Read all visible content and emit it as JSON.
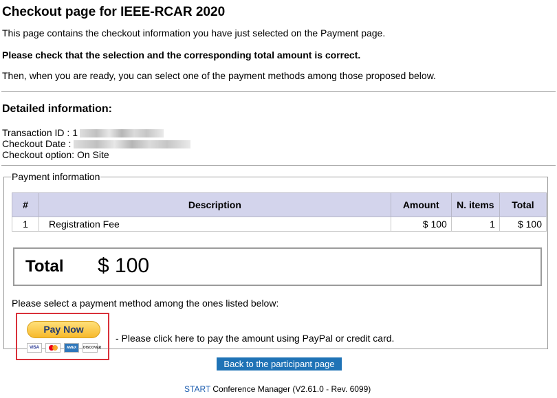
{
  "page": {
    "title": "Checkout page for IEEE-RCAR 2020",
    "intro": "This page contains the checkout information you have just selected on the Payment page.",
    "warning": "Please check that the selection and the corresponding total amount is correct.",
    "instruction": "Then, when you are ready, you can select one of the payment methods among those proposed below."
  },
  "details": {
    "heading": "Detailed information:",
    "transaction_label": "Transaction ID : ",
    "transaction_value_visible": "1",
    "checkout_date_label": "Checkout Date : ",
    "checkout_option_label": "Checkout option: ",
    "checkout_option_value": "On Site"
  },
  "payment_info": {
    "legend": "Payment information",
    "columns": [
      "#",
      "Description",
      "Amount",
      "N. items",
      "Total"
    ],
    "rows": [
      {
        "num": "1",
        "description": "Registration Fee",
        "amount": "$ 100",
        "n_items": "1",
        "total": "$ 100"
      }
    ],
    "total_label": "Total",
    "total_value": "$ 100",
    "select_message": "Please select a payment method among the ones listed below:",
    "paypal_button": "Pay Now",
    "cards": [
      "VISA",
      "MC",
      "AMEX",
      "DISCOVER"
    ],
    "paypal_message": "- Please click here to pay the amount using PayPal or credit card."
  },
  "actions": {
    "back_button": "Back to the participant page"
  },
  "footer": {
    "link": "START",
    "text": " Conference Manager (V2.61.0 - Rev. 6099)"
  },
  "colors": {
    "table_header_bg": "#d3d4ec",
    "back_button_bg": "#1f73b6",
    "highlight_border": "#d9313a",
    "paypal_yellow": "#f7b92b"
  }
}
